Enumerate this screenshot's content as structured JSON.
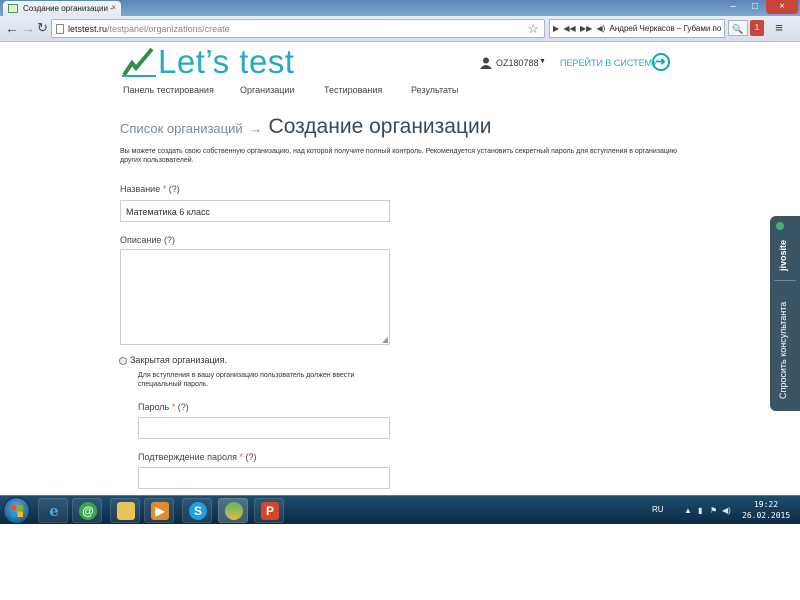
{
  "browser": {
    "tab_title": "Создание организации -",
    "tab_close": "×",
    "url_domain": "letstest.ru",
    "url_path": "/testpanel/organizations/create",
    "media_text": "Андрей Черкасов – Губами по те",
    "window_buttons": [
      "–",
      "□",
      "×"
    ]
  },
  "site": {
    "logo_text": "Let’s test",
    "nav": [
      "Панель тестирования",
      "Организации",
      "Тестирования",
      "Результаты"
    ],
    "user_name": "OZ180788",
    "user_caret": "▼",
    "go_system": "ПЕРЕЙТИ В СИСТЕМУ",
    "go_system_icon": "➔"
  },
  "main": {
    "breadcrumb_link": "Список организаций",
    "breadcrumb_arrow": "→",
    "title": "Создание организации",
    "intro": "Вы можете создать свою собственную организацию, над которой получите полный контроль. Рекомендуется установить секретный пароль для вступления в организацию других пользователей.",
    "fields": {
      "name": {
        "label": "Название",
        "required": "*",
        "help": "(?)",
        "value": "Математика 6 класс"
      },
      "description": {
        "label": "Описание",
        "help": "(?)",
        "value": ""
      },
      "password": {
        "label": "Пароль",
        "required": "*",
        "help": "(?)",
        "value": ""
      },
      "password_confirm": {
        "label": "Подтверждение пароля",
        "required": "*",
        "help": "(?)",
        "value": ""
      }
    },
    "closed_org": {
      "label": "Закрытая организация.",
      "hint": "Для вступления в вашу организацию пользователь должен ввести специальный пароль.",
      "checked": false
    }
  },
  "jivo": {
    "label": "Спросить консультанта",
    "brand": "jivosite"
  },
  "taskbar": {
    "lang": "RU",
    "time": "19:22",
    "date": "26.02.2015",
    "apps": [
      "ie-icon",
      "mail-agent-icon",
      "explorer-icon",
      "media-player-icon",
      "skype-icon",
      "chrome-icon",
      "powerpoint-icon"
    ]
  },
  "colors": {
    "brand": "#27a9c5",
    "required": "#e05a3d",
    "jivo": "#3b5564",
    "taskbar": "#0d2a44"
  }
}
